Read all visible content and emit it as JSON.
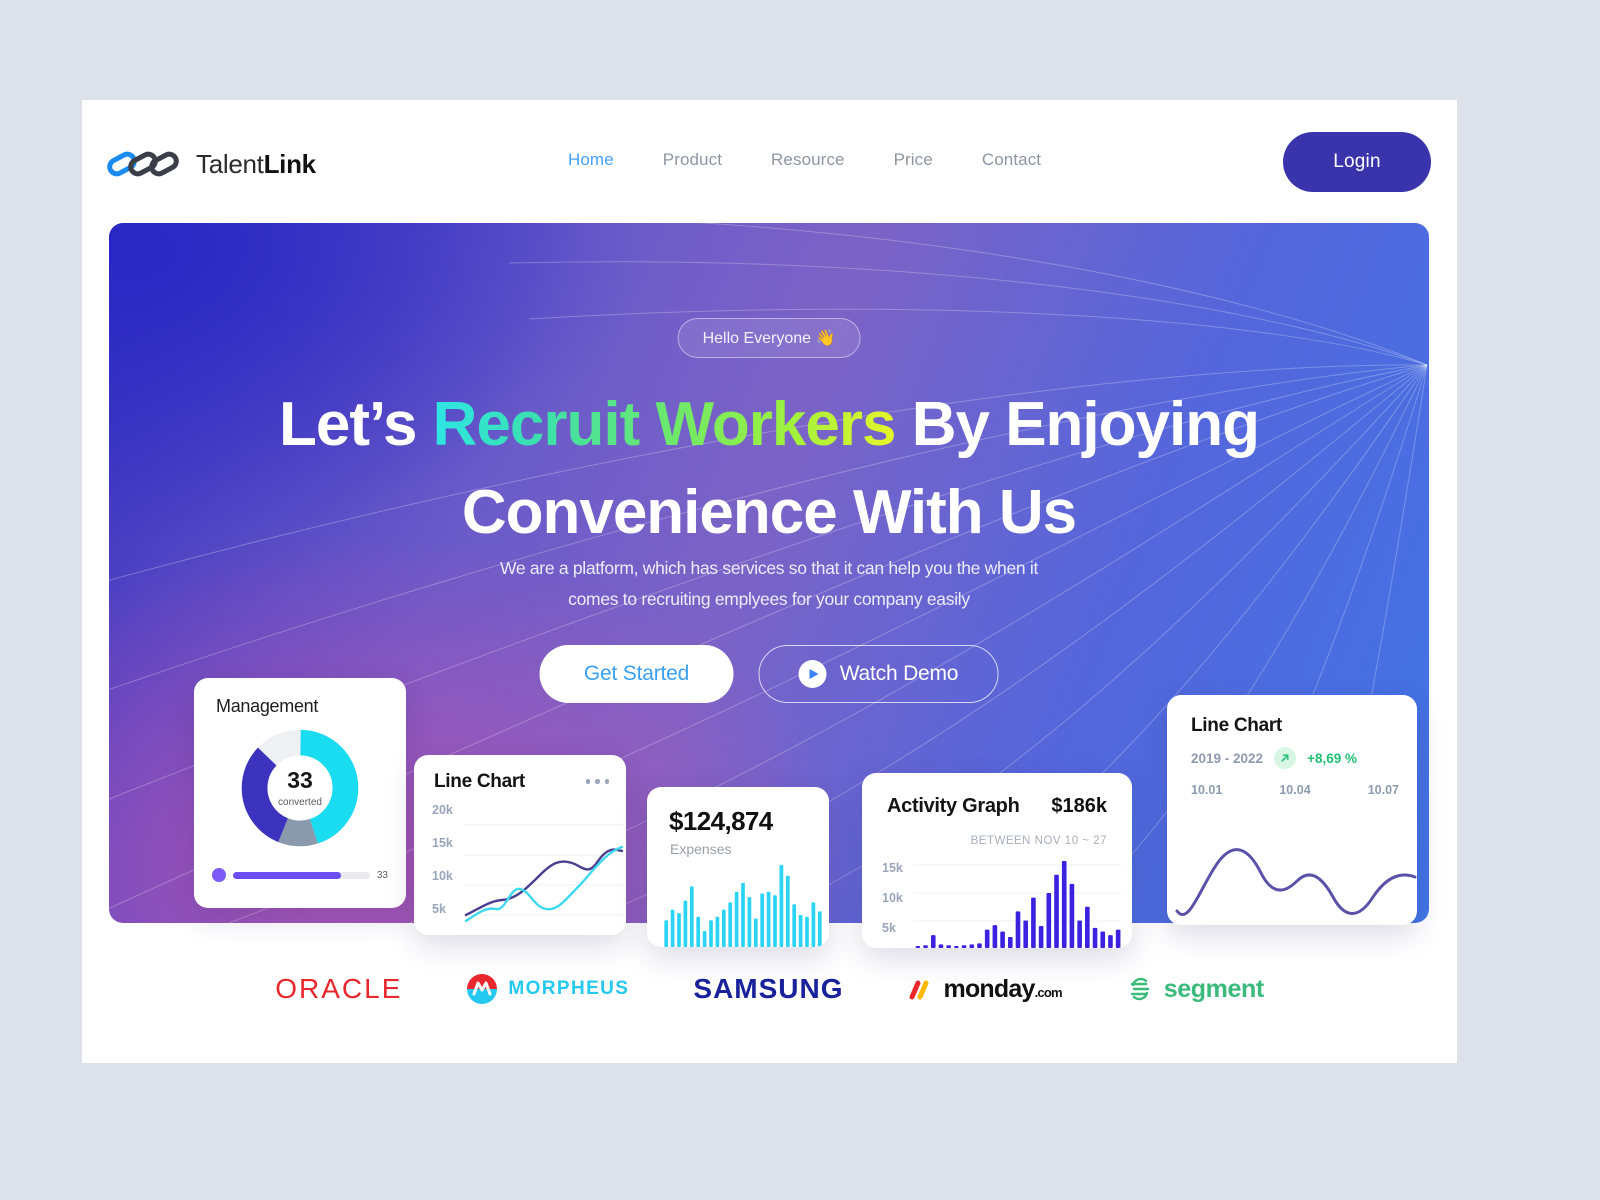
{
  "brand": {
    "name_light": "Talent",
    "name_bold": "Link",
    "logo_icon": "three-linked-rings-icon"
  },
  "nav": {
    "items": [
      {
        "label": "Home",
        "active": true
      },
      {
        "label": "Product",
        "active": false
      },
      {
        "label": "Resource",
        "active": false
      },
      {
        "label": "Price",
        "active": false
      },
      {
        "label": "Contact",
        "active": false
      }
    ],
    "login_label": "Login",
    "login_color": "#3a34ac"
  },
  "hero": {
    "badge": "Hello Everyone 👋",
    "headline_part1": "Let’s ",
    "headline_highlight": "Recruit Workers",
    "headline_part2": " By Enjoying",
    "headline_line2": "Convenience With Us",
    "highlight_gradient_from": "#2ee6e6",
    "highlight_gradient_to": "#e9f52a",
    "subtitle_line1": "We are a platform, which has services so that it can help you the when it",
    "subtitle_line2": "comes to recruiting emplyees for your company easily",
    "cta_primary": "Get Started",
    "cta_secondary": "Watch Demo",
    "play_icon": "play-icon"
  },
  "cards": {
    "management": {
      "title": "Management",
      "value": "33",
      "caption": "converted",
      "slider_value": "33",
      "slider_fill_pct": 79,
      "donut": {
        "segments": [
          {
            "name": "cyan",
            "color": "#19dcf0",
            "pct": 45
          },
          {
            "name": "gray",
            "color": "#8a99ab",
            "pct": 11
          },
          {
            "name": "indigo",
            "color": "#3b33bd",
            "pct": 31
          },
          {
            "name": "cyan-top",
            "color": "#19dcf0",
            "pct": 13
          }
        ]
      }
    },
    "line_small": {
      "title": "Line Chart",
      "menu_icon": "more-dots-icon",
      "y_labels": [
        "20k",
        "15k",
        "10k",
        "5k"
      ],
      "series": [
        {
          "name": "purple",
          "color": "#4b3f8f"
        },
        {
          "name": "cyan",
          "color": "#3ed8f0"
        }
      ]
    },
    "expenses": {
      "amount": "$124,874",
      "label": "Expenses",
      "bar_color": "#2ad4f5",
      "bars": [
        30,
        42,
        38,
        52,
        68,
        34,
        18,
        30,
        34,
        42,
        50,
        62,
        72,
        56,
        32,
        60,
        62,
        58,
        92,
        80,
        48,
        36,
        34,
        50,
        40
      ]
    },
    "activity": {
      "title": "Activity Graph",
      "amount": "$186k",
      "range": "BETWEEN NOV 10 ~ 27",
      "y_labels": [
        "15k",
        "10k",
        "5k"
      ],
      "bar_color": "#3a22e0",
      "bars": [
        2,
        3,
        14,
        4,
        3,
        2,
        3,
        4,
        5,
        20,
        25,
        18,
        12,
        40,
        30,
        55,
        24,
        60,
        80,
        95,
        70,
        30,
        45,
        22,
        18,
        14,
        20
      ]
    },
    "line_right": {
      "title": "Line Chart",
      "range": "2019 - 2022",
      "trend_icon": "arrow-up-right-icon",
      "change": "+8,69 %",
      "change_color": "#1fc274",
      "x_ticks": [
        "10.01",
        "10.04",
        "10.07"
      ],
      "line_color": "#5a51a8"
    }
  },
  "partners": [
    {
      "name": "ORACLE",
      "style": "oracle"
    },
    {
      "name": "MORPHEUS",
      "style": "morpheus"
    },
    {
      "name": "SAMSUNG",
      "style": "samsung"
    },
    {
      "name": "monday",
      "suffix": ".com",
      "style": "monday"
    },
    {
      "name": "segment",
      "style": "segment"
    }
  ]
}
